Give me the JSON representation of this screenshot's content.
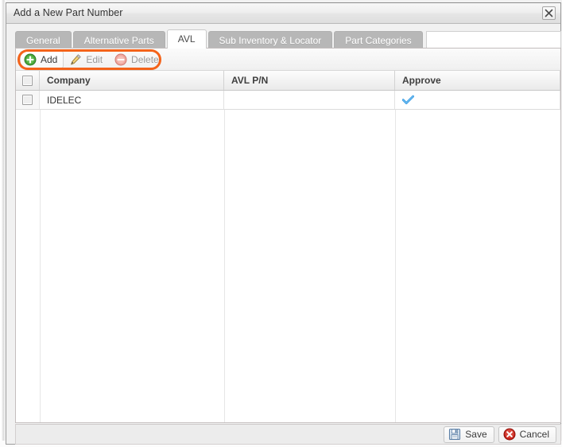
{
  "window": {
    "title": "Add a New Part Number",
    "close_icon": "close-x-icon",
    "close_label": "Close"
  },
  "tabs": [
    {
      "label": "General",
      "active": false
    },
    {
      "label": "Alternative Parts",
      "active": false
    },
    {
      "label": "AVL",
      "active": true
    },
    {
      "label": "Sub Inventory & Locator",
      "active": false
    },
    {
      "label": "Part Categories",
      "active": false
    }
  ],
  "toolbar": {
    "add_label": "Add",
    "add_icon": "green-plus-circle-icon",
    "edit_label": "Edit",
    "edit_icon": "pencil-icon",
    "delete_label": "Delete",
    "delete_icon": "red-minus-circle-icon"
  },
  "highlight": {
    "color": "#f4631a",
    "target": "toolbar-buttons"
  },
  "grid": {
    "select_all_icon": "checkbox-unchecked-icon",
    "columns": [
      "Company",
      "AVL P/N",
      "Approve"
    ],
    "rows": [
      {
        "selected": false,
        "company": "IDELEC",
        "avl_pn": "",
        "approve": true,
        "approve_icon": "blue-check-icon"
      }
    ]
  },
  "footer": {
    "save_label": "Save",
    "save_icon": "floppy-disk-icon",
    "cancel_label": "Cancel",
    "cancel_icon": "red-x-circle-icon"
  },
  "colors": {
    "highlight_orange": "#f4631a",
    "approve_check_blue": "#3c9ee5",
    "tab_inactive": "#b7b7b7",
    "dialog_bg": "#f1f1f1"
  }
}
